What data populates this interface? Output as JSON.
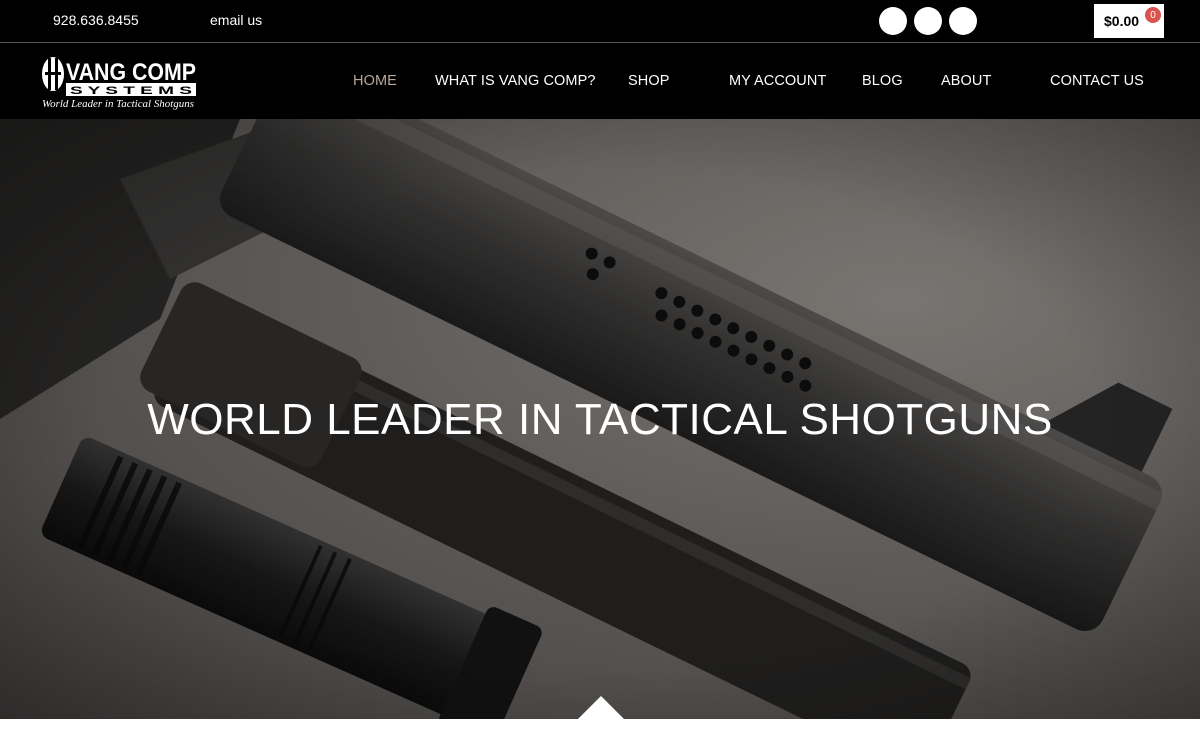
{
  "topbar": {
    "phone": "928.636.8455",
    "email": "email us",
    "social_icons": [
      "social-icon-1",
      "social-icon-2",
      "social-icon-3"
    ],
    "cart": {
      "total": "$0.00",
      "count": "0"
    }
  },
  "header": {
    "logo": {
      "line1": "VANG COMP",
      "line2": "S Y S T E M S",
      "tagline": "World Leader in Tactical Shotguns"
    },
    "nav": [
      {
        "label": "HOME",
        "active": true
      },
      {
        "label": "WHAT IS VANG COMP?"
      },
      {
        "label": "SHOP"
      },
      {
        "label": "MY ACCOUNT"
      },
      {
        "label": "BLOG"
      },
      {
        "label": "ABOUT"
      },
      {
        "label": "CONTACT US"
      }
    ]
  },
  "hero": {
    "title": "WORLD LEADER IN TACTICAL SHOTGUNS",
    "image": "shotgun-with-flashlight"
  },
  "colors": {
    "bar_bg": "#000000",
    "nav_active": "#b8a89a",
    "cart_badge": "#d9534f"
  }
}
